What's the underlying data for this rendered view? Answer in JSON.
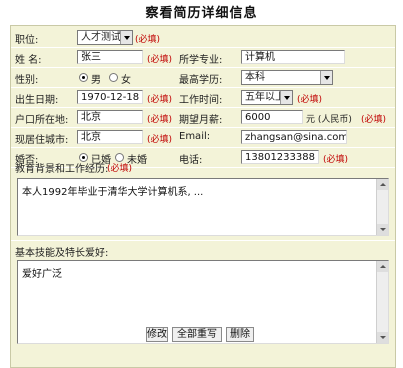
{
  "page_title": "察看简历详细信息",
  "form": {
    "position_label": "职位:",
    "position_value": "人才测试",
    "position_required": "(必填)",
    "name_label": "姓 名:",
    "name_value": "张三",
    "name_required": "(必填)",
    "major_label": "所学专业:",
    "major_value": "计算机",
    "gender_label": "性别:",
    "gender_options": [
      "男",
      "女"
    ],
    "gender_selected": "男",
    "education_label": "最高学历:",
    "education_value": "本科",
    "birth_label": "出生日期:",
    "birth_value": "1970-12-18",
    "birth_required": "(必填)",
    "workyears_label": "工作时间:",
    "workyears_value": "五年以上",
    "workyears_required": "(必填)",
    "hukou_label": "户口所在地:",
    "hukou_value": "北京",
    "hukou_required": "(必填)",
    "salary_label": "期望月薪:",
    "salary_value": "6000",
    "salary_unit": "元 (人民币)",
    "salary_required": "(必填)",
    "city_label": "现居住城市:",
    "city_value": "北京",
    "city_required": "(必填)",
    "email_label": "Email:",
    "email_value": "zhangsan@sina.com",
    "marital_label": "婚否:",
    "marital_options": [
      "已婚",
      "未婚"
    ],
    "marital_selected": "已婚",
    "phone_label": "电话:",
    "phone_value": "13801233388",
    "phone_required": "(必填)",
    "experience_label": "教育背景和工作经历:",
    "experience_required": "(必填)",
    "experience_value": "本人1992年毕业于清华大学计算机系, ...",
    "skills_label": "基本技能及特长爱好:",
    "skills_value": "爱好广泛"
  },
  "buttons": {
    "modify": "修改",
    "rewrite": "全部重写",
    "delete": "删除"
  }
}
